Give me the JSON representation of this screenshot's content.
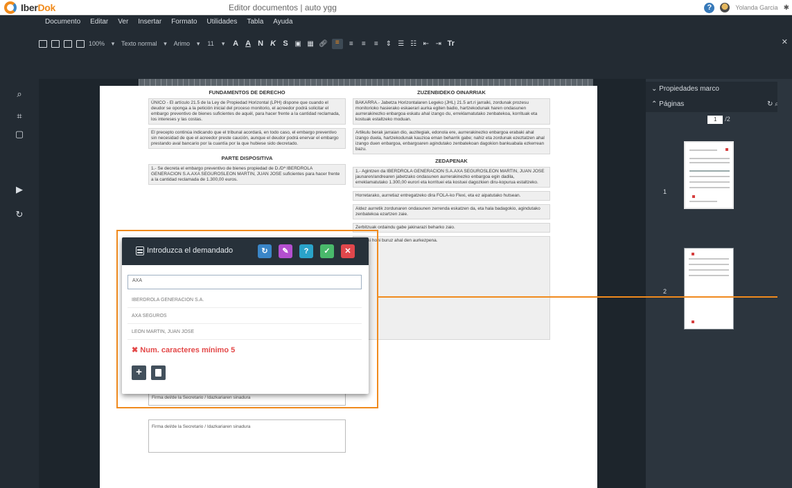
{
  "app": {
    "brand_main": "Iber",
    "brand_accent": "Dok",
    "doc_title": "Editor documentos  |  auto ygg",
    "user_name": "Yolanda Garcia",
    "colors": {
      "accent_orange": "#f18b1c",
      "header_dark": "#232b33",
      "blue": "#3a86c8"
    }
  },
  "menu": {
    "items": [
      "Documento",
      "Editar",
      "Ver",
      "Insertar",
      "Formato",
      "Utilidades",
      "Tabla",
      "Ayuda"
    ]
  },
  "toolbar": {
    "zoom": "100%",
    "style": "Texto normal",
    "font": "Arimo",
    "size": "11",
    "font_color": "A",
    "highlight_color": "A",
    "bold": "N",
    "italic": "K",
    "strike": "S",
    "clear_format": "Tr"
  },
  "document": {
    "left": {
      "title": "FUNDAMENTOS DE DERECHO",
      "p1": "ÚNICO - El artículo 21.5 de la Ley de Propiedad Horizontal (LPH) dispone que cuando el deudor se oponga a la petición inicial del proceso monitorio, el acreedor podrá solicitar el embargo preventivo de bienes suficientes de aquél, para hacer frente a la cantidad reclamada, los intereses y las costas.",
      "p2": "El precepto continúa indicando que el tribunal acordará, en todo caso, el embargo preventivo sin necesidad de que el acreedor preste caución, aunque el deudor podrá enervar el embargo prestando aval bancario por la cuantía por la que hubiese sido decretado.",
      "title2": "PARTE DISPOSITIVA",
      "p3": "1.- Se decreta el embargo preventivo de bienes propiedad de D./Dª IBERDROLA GENERACION S.A.AXA SEGUROSLEON MARTIN, JUAN JOSE suficientes para hacer frente a la cantidad reclamada de 1.300,00 euros.",
      "sign1": "Firma del/de la Secretario / Idazkariaren sinadura",
      "sign2": "Firma del/de la Secretario / Idazkariaren sinadura"
    },
    "right": {
      "title": "ZUZENBIDEKO OINARRIAK",
      "p1": "BAKARRA.- Jabetza Horizontalaren Legeko (JHL) 21.5 art.ri jarraiki, zordunak prozesu monitorioko hasierako eskaerari aurka egiten badio, hartzekodunak haren ondasunen aurrerakinezko enbargoa eskatu ahal izango du, erreklamatutako zenbatekoa, korrituak eta kostuak estaltzeko moduan.",
      "p2": "Artikulu berak jarraian dio, auzitegiak, edonola ere, aurrerakinezko enbargoa erabaki ahal izango duela, hartzekodunak kauzioa eman beharrik gabe; nahiz eta zordunak ezeztatzen ahal izango duen enbargoa, enbargoaren agindutako zenbatekoan dagokion bankuabala ezkerrean bazu.",
      "title2": "ZEDAPENAK",
      "p3": "1.- Agintzen da IBERDROLA GENERACION S.A.AXA SEGUROSLEON MARTIN, JUAN JOSE jaunaren/andrearen jabetzako ondasunen aurrerakinezko enbargoa egin dadila, erreklamatutako 1.300,00 eurori eta korrituei eta kostuei dagozkien diru-kopurua estaltzeko.",
      "p4": "Horretarako, aurretiaz entregatzeko dira FOLA-ko Flexi, eta ez aipatutako hutsean.",
      "p5": "Aldez aurretik zordunaren ondasunen zerrenda eskatzen da, eta hala badagokio, agindutako zenbatekoa ezartzen zaie.",
      "p6": "Zerbitzuak ordaindu gabe jakinarazi beharko zaio.",
      "p7": "Erabaki honi buruz ahal den aurkezpena."
    }
  },
  "right_panel": {
    "props_header": "Propiedades marco",
    "pages_header": "Páginas",
    "current_page": "1",
    "total_pages": "/2",
    "thumb1_label": "1",
    "thumb2_label": "2"
  },
  "dialog": {
    "title": "Introduzca el demandado",
    "input_value": "AXA",
    "options": [
      "IBERDROLA GENERACION S.A.",
      "AXA SEGUROS",
      "LEON MARTIN, JUAN JOSE"
    ],
    "error": "Num. caracteres mínimo 5",
    "buttons": {
      "refresh": "↻",
      "edit": "✎",
      "help": "?",
      "confirm": "✓",
      "close": "✕"
    },
    "add_label": "+",
    "colors": {
      "refresh": "#3a86c8",
      "edit": "#b44fd0",
      "help": "#2aa3c9",
      "confirm": "#49b96b",
      "close": "#e0474c",
      "error": "#e34848"
    }
  }
}
